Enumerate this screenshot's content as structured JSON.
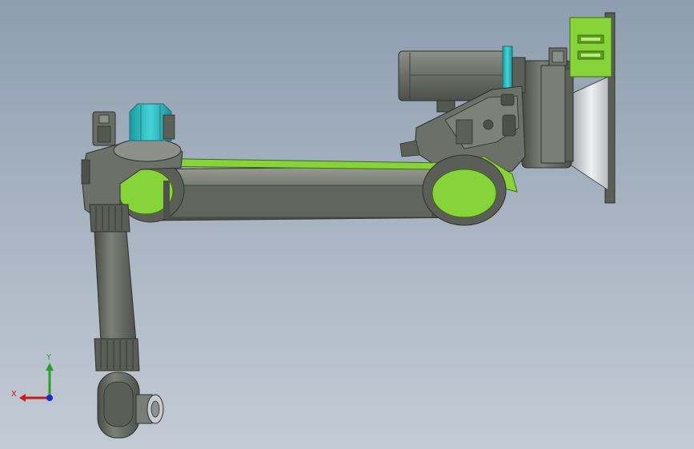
{
  "viewport": {
    "background_top": "#8e9eb0",
    "background_bottom": "#c3cbd5"
  },
  "model": {
    "colors": {
      "body": "#6b6e66",
      "body_light": "#8a8d84",
      "body_dark": "#3e413c",
      "accent_green": "#86d43a",
      "accent_cyan": "#35c4c8",
      "flange": "#d8dadc"
    }
  },
  "triad": {
    "x_label": "X",
    "y_label": "Y",
    "x_color": "#cc1a1a",
    "y_color": "#2aa02a",
    "z_color": "#1a2acc"
  }
}
